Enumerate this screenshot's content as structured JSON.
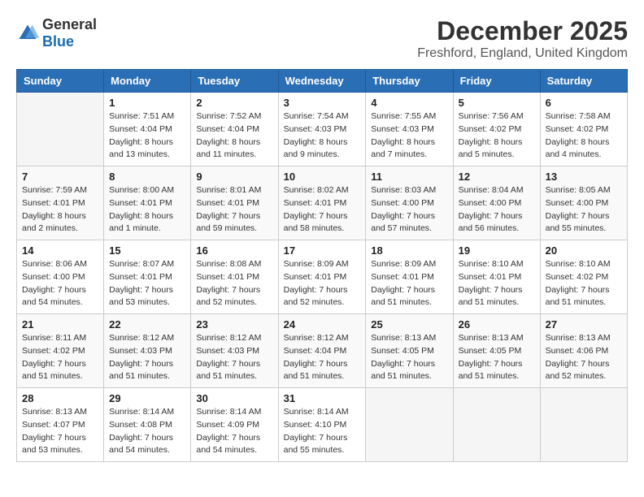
{
  "header": {
    "logo_general": "General",
    "logo_blue": "Blue",
    "title": "December 2025",
    "subtitle": "Freshford, England, United Kingdom"
  },
  "days_of_week": [
    "Sunday",
    "Monday",
    "Tuesday",
    "Wednesday",
    "Thursday",
    "Friday",
    "Saturday"
  ],
  "weeks": [
    [
      {
        "day": "",
        "sunrise": "",
        "sunset": "",
        "daylight": ""
      },
      {
        "day": "1",
        "sunrise": "Sunrise: 7:51 AM",
        "sunset": "Sunset: 4:04 PM",
        "daylight": "Daylight: 8 hours and 13 minutes."
      },
      {
        "day": "2",
        "sunrise": "Sunrise: 7:52 AM",
        "sunset": "Sunset: 4:04 PM",
        "daylight": "Daylight: 8 hours and 11 minutes."
      },
      {
        "day": "3",
        "sunrise": "Sunrise: 7:54 AM",
        "sunset": "Sunset: 4:03 PM",
        "daylight": "Daylight: 8 hours and 9 minutes."
      },
      {
        "day": "4",
        "sunrise": "Sunrise: 7:55 AM",
        "sunset": "Sunset: 4:03 PM",
        "daylight": "Daylight: 8 hours and 7 minutes."
      },
      {
        "day": "5",
        "sunrise": "Sunrise: 7:56 AM",
        "sunset": "Sunset: 4:02 PM",
        "daylight": "Daylight: 8 hours and 5 minutes."
      },
      {
        "day": "6",
        "sunrise": "Sunrise: 7:58 AM",
        "sunset": "Sunset: 4:02 PM",
        "daylight": "Daylight: 8 hours and 4 minutes."
      }
    ],
    [
      {
        "day": "7",
        "sunrise": "Sunrise: 7:59 AM",
        "sunset": "Sunset: 4:01 PM",
        "daylight": "Daylight: 8 hours and 2 minutes."
      },
      {
        "day": "8",
        "sunrise": "Sunrise: 8:00 AM",
        "sunset": "Sunset: 4:01 PM",
        "daylight": "Daylight: 8 hours and 1 minute."
      },
      {
        "day": "9",
        "sunrise": "Sunrise: 8:01 AM",
        "sunset": "Sunset: 4:01 PM",
        "daylight": "Daylight: 7 hours and 59 minutes."
      },
      {
        "day": "10",
        "sunrise": "Sunrise: 8:02 AM",
        "sunset": "Sunset: 4:01 PM",
        "daylight": "Daylight: 7 hours and 58 minutes."
      },
      {
        "day": "11",
        "sunrise": "Sunrise: 8:03 AM",
        "sunset": "Sunset: 4:00 PM",
        "daylight": "Daylight: 7 hours and 57 minutes."
      },
      {
        "day": "12",
        "sunrise": "Sunrise: 8:04 AM",
        "sunset": "Sunset: 4:00 PM",
        "daylight": "Daylight: 7 hours and 56 minutes."
      },
      {
        "day": "13",
        "sunrise": "Sunrise: 8:05 AM",
        "sunset": "Sunset: 4:00 PM",
        "daylight": "Daylight: 7 hours and 55 minutes."
      }
    ],
    [
      {
        "day": "14",
        "sunrise": "Sunrise: 8:06 AM",
        "sunset": "Sunset: 4:00 PM",
        "daylight": "Daylight: 7 hours and 54 minutes."
      },
      {
        "day": "15",
        "sunrise": "Sunrise: 8:07 AM",
        "sunset": "Sunset: 4:01 PM",
        "daylight": "Daylight: 7 hours and 53 minutes."
      },
      {
        "day": "16",
        "sunrise": "Sunrise: 8:08 AM",
        "sunset": "Sunset: 4:01 PM",
        "daylight": "Daylight: 7 hours and 52 minutes."
      },
      {
        "day": "17",
        "sunrise": "Sunrise: 8:09 AM",
        "sunset": "Sunset: 4:01 PM",
        "daylight": "Daylight: 7 hours and 52 minutes."
      },
      {
        "day": "18",
        "sunrise": "Sunrise: 8:09 AM",
        "sunset": "Sunset: 4:01 PM",
        "daylight": "Daylight: 7 hours and 51 minutes."
      },
      {
        "day": "19",
        "sunrise": "Sunrise: 8:10 AM",
        "sunset": "Sunset: 4:01 PM",
        "daylight": "Daylight: 7 hours and 51 minutes."
      },
      {
        "day": "20",
        "sunrise": "Sunrise: 8:10 AM",
        "sunset": "Sunset: 4:02 PM",
        "daylight": "Daylight: 7 hours and 51 minutes."
      }
    ],
    [
      {
        "day": "21",
        "sunrise": "Sunrise: 8:11 AM",
        "sunset": "Sunset: 4:02 PM",
        "daylight": "Daylight: 7 hours and 51 minutes."
      },
      {
        "day": "22",
        "sunrise": "Sunrise: 8:12 AM",
        "sunset": "Sunset: 4:03 PM",
        "daylight": "Daylight: 7 hours and 51 minutes."
      },
      {
        "day": "23",
        "sunrise": "Sunrise: 8:12 AM",
        "sunset": "Sunset: 4:03 PM",
        "daylight": "Daylight: 7 hours and 51 minutes."
      },
      {
        "day": "24",
        "sunrise": "Sunrise: 8:12 AM",
        "sunset": "Sunset: 4:04 PM",
        "daylight": "Daylight: 7 hours and 51 minutes."
      },
      {
        "day": "25",
        "sunrise": "Sunrise: 8:13 AM",
        "sunset": "Sunset: 4:05 PM",
        "daylight": "Daylight: 7 hours and 51 minutes."
      },
      {
        "day": "26",
        "sunrise": "Sunrise: 8:13 AM",
        "sunset": "Sunset: 4:05 PM",
        "daylight": "Daylight: 7 hours and 51 minutes."
      },
      {
        "day": "27",
        "sunrise": "Sunrise: 8:13 AM",
        "sunset": "Sunset: 4:06 PM",
        "daylight": "Daylight: 7 hours and 52 minutes."
      }
    ],
    [
      {
        "day": "28",
        "sunrise": "Sunrise: 8:13 AM",
        "sunset": "Sunset: 4:07 PM",
        "daylight": "Daylight: 7 hours and 53 minutes."
      },
      {
        "day": "29",
        "sunrise": "Sunrise: 8:14 AM",
        "sunset": "Sunset: 4:08 PM",
        "daylight": "Daylight: 7 hours and 54 minutes."
      },
      {
        "day": "30",
        "sunrise": "Sunrise: 8:14 AM",
        "sunset": "Sunset: 4:09 PM",
        "daylight": "Daylight: 7 hours and 54 minutes."
      },
      {
        "day": "31",
        "sunrise": "Sunrise: 8:14 AM",
        "sunset": "Sunset: 4:10 PM",
        "daylight": "Daylight: 7 hours and 55 minutes."
      },
      {
        "day": "",
        "sunrise": "",
        "sunset": "",
        "daylight": ""
      },
      {
        "day": "",
        "sunrise": "",
        "sunset": "",
        "daylight": ""
      },
      {
        "day": "",
        "sunrise": "",
        "sunset": "",
        "daylight": ""
      }
    ]
  ]
}
